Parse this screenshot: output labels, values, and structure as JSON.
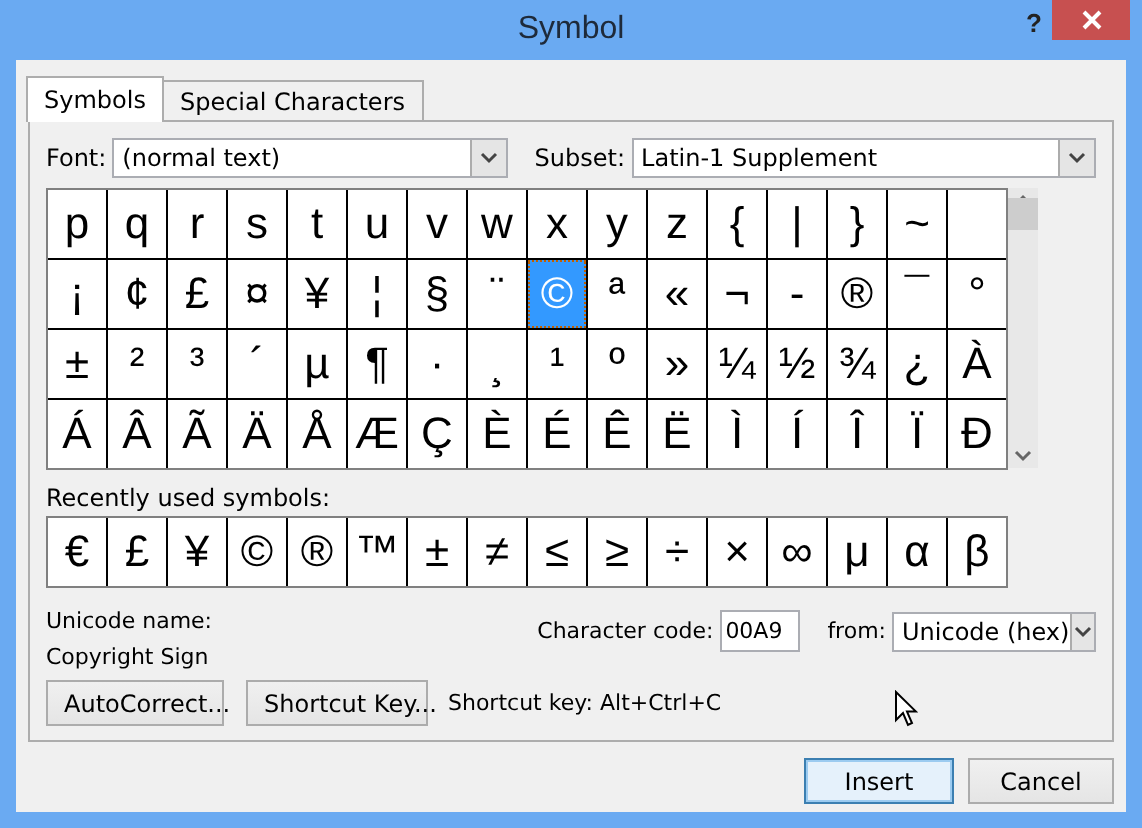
{
  "window": {
    "title": "Symbol",
    "help": "?"
  },
  "tabs": [
    {
      "label": "Symbols",
      "selected": true
    },
    {
      "label": "Special Characters",
      "selected": false
    }
  ],
  "font": {
    "label": "Font:",
    "value": "(normal text)"
  },
  "subset": {
    "label": "Subset:",
    "value": "Latin-1 Supplement"
  },
  "symbol_grid": {
    "cells": [
      {
        "char": "p",
        "selected": false
      },
      {
        "char": "q",
        "selected": false
      },
      {
        "char": "r",
        "selected": false
      },
      {
        "char": "s",
        "selected": false
      },
      {
        "char": "t",
        "selected": false
      },
      {
        "char": "u",
        "selected": false
      },
      {
        "char": "v",
        "selected": false
      },
      {
        "char": "w",
        "selected": false
      },
      {
        "char": "x",
        "selected": false
      },
      {
        "char": "y",
        "selected": false
      },
      {
        "char": "z",
        "selected": false
      },
      {
        "char": "{",
        "selected": false
      },
      {
        "char": "|",
        "selected": false
      },
      {
        "char": "}",
        "selected": false
      },
      {
        "char": "~",
        "selected": false
      },
      {
        "selected": false
      },
      {
        "char": "¡",
        "selected": false
      },
      {
        "char": "¢",
        "selected": false
      },
      {
        "char": "£",
        "selected": false
      },
      {
        "char": "¤",
        "selected": false
      },
      {
        "char": "¥",
        "selected": false
      },
      {
        "char": "¦",
        "selected": false
      },
      {
        "char": "§",
        "selected": false
      },
      {
        "char": "¨",
        "selected": false
      },
      {
        "char": "©",
        "selected": true
      },
      {
        "char": "ª",
        "selected": false
      },
      {
        "char": "«",
        "selected": false
      },
      {
        "char": "¬",
        "selected": false
      },
      {
        "char": "-",
        "selected": false
      },
      {
        "char": "®",
        "selected": false
      },
      {
        "char": "¯",
        "selected": false
      },
      {
        "char": "°",
        "selected": false
      },
      {
        "char": "±",
        "selected": false
      },
      {
        "char": "²",
        "selected": false
      },
      {
        "char": "³",
        "selected": false
      },
      {
        "char": "´",
        "selected": false
      },
      {
        "char": "µ",
        "selected": false
      },
      {
        "char": "¶",
        "selected": false
      },
      {
        "char": "·",
        "selected": false
      },
      {
        "char": "¸",
        "selected": false
      },
      {
        "char": "¹",
        "selected": false
      },
      {
        "char": "º",
        "selected": false
      },
      {
        "char": "»",
        "selected": false
      },
      {
        "char": "¼",
        "selected": false
      },
      {
        "char": "½",
        "selected": false
      },
      {
        "char": "¾",
        "selected": false
      },
      {
        "char": "¿",
        "selected": false
      },
      {
        "char": "À",
        "selected": false
      },
      {
        "char": "Á",
        "selected": false
      },
      {
        "char": "Â",
        "selected": false
      },
      {
        "char": "Ã",
        "selected": false
      },
      {
        "char": "Ä",
        "selected": false
      },
      {
        "char": "Å",
        "selected": false
      },
      {
        "char": "Æ",
        "selected": false
      },
      {
        "char": "Ç",
        "selected": false
      },
      {
        "char": "È",
        "selected": false
      },
      {
        "char": "É",
        "selected": false
      },
      {
        "char": "Ê",
        "selected": false
      },
      {
        "char": "Ë",
        "selected": false
      },
      {
        "char": "Ì",
        "selected": false
      },
      {
        "char": "Í",
        "selected": false
      },
      {
        "char": "Î",
        "selected": false
      },
      {
        "char": "Ï",
        "selected": false
      },
      {
        "char": "Ð",
        "selected": false
      }
    ]
  },
  "recent": {
    "label": "Recently used symbols:",
    "symbols": [
      "€",
      "£",
      "¥",
      "©",
      "®",
      "™",
      "±",
      "≠",
      "≤",
      "≥",
      "÷",
      "×",
      "∞",
      "μ",
      "α",
      "β"
    ]
  },
  "unicode_name": {
    "label": "Unicode name:",
    "value": "Copyright Sign"
  },
  "character_code": {
    "label": "Character code:",
    "value": "00A9"
  },
  "from": {
    "label": "from:",
    "value": "Unicode (hex)"
  },
  "buttons": [
    {
      "label": "AutoCorrect..."
    },
    {
      "label": "Shortcut Key..."
    }
  ],
  "shortcut_text": "Shortcut key: Alt+Ctrl+C",
  "dialog_buttons": [
    {
      "label": "Insert",
      "default": true
    },
    {
      "label": "Cancel",
      "default": false
    }
  ]
}
